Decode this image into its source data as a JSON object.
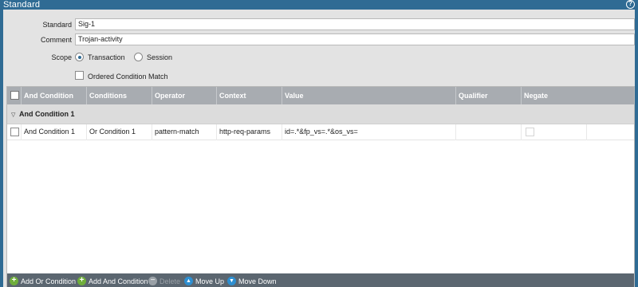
{
  "window": {
    "title": "Standard",
    "help_glyph": "?"
  },
  "form": {
    "standard_label": "Standard",
    "standard_value": "Sig-1",
    "comment_label": "Comment",
    "comment_value": "Trojan-activity",
    "scope_label": "Scope",
    "scope_options": [
      "Transaction",
      "Session"
    ],
    "scope_selected": "Transaction",
    "ordered_label": "Ordered Condition Match",
    "ordered_checked": false
  },
  "table": {
    "columns": [
      "And Condition",
      "Conditions",
      "Operator",
      "Context",
      "Value",
      "Qualifier",
      "Negate"
    ],
    "group": {
      "label": "And Condition 1",
      "expanded": true
    },
    "rows": [
      {
        "and_condition": "And Condition 1",
        "conditions": "Or Condition 1",
        "operator": "pattern-match",
        "context": "http-req-params",
        "value": "id=.*&fp_vs=.*&os_vs=",
        "qualifier": "",
        "negate": false
      }
    ]
  },
  "footer": {
    "add_or": "Add Or Condition",
    "add_and": "Add And Condition",
    "delete": "Delete",
    "move_up": "Move Up",
    "move_down": "Move Down"
  },
  "colors": {
    "accent": "#2f6b94",
    "header": "#a8acb1",
    "footer": "#5b6670",
    "add_icon": "#6fae3b",
    "move_icon": "#2e8fd1"
  }
}
